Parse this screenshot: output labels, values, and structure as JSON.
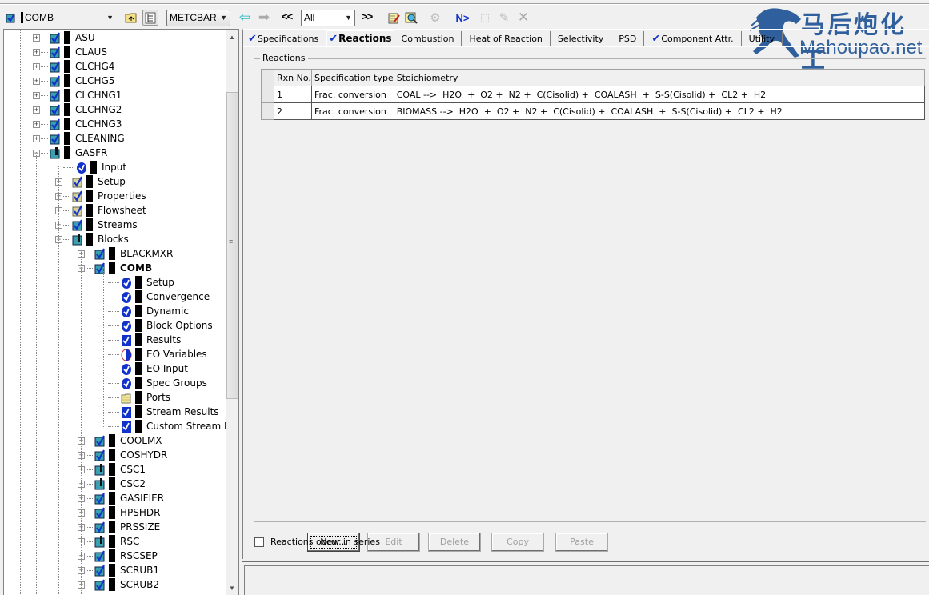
{
  "toolbar": {
    "block_selector": "COMB",
    "units_selector": "METCBAR",
    "filter_selector": "All",
    "prev_label": "<<",
    "next_label": ">>",
    "next_input_label": "N>"
  },
  "logo": {
    "chinese": "马后炮化工",
    "english": "Mahoupao.net"
  },
  "tree": {
    "items": [
      {
        "label": "ASU",
        "level": 1,
        "expander": "+",
        "icon": "block-ok"
      },
      {
        "label": "CLAUS",
        "level": 1,
        "expander": "+",
        "icon": "block-ok"
      },
      {
        "label": "CLCHG4",
        "level": 1,
        "expander": "+",
        "icon": "block-ok"
      },
      {
        "label": "CLCHG5",
        "level": 1,
        "expander": "+",
        "icon": "block-ok"
      },
      {
        "label": "CLCHNG1",
        "level": 1,
        "expander": "+",
        "icon": "block-ok"
      },
      {
        "label": "CLCHNG2",
        "level": 1,
        "expander": "+",
        "icon": "block-ok"
      },
      {
        "label": "CLCHNG3",
        "level": 1,
        "expander": "+",
        "icon": "block-ok"
      },
      {
        "label": "CLEANING",
        "level": 1,
        "expander": "+",
        "icon": "block-ok"
      },
      {
        "label": "GASFR",
        "level": 1,
        "expander": "-",
        "icon": "block-incomplete"
      },
      {
        "label": "Input",
        "level": 2,
        "expander": "",
        "icon": "form-ok"
      },
      {
        "label": "Setup",
        "level": 2,
        "expander": "+",
        "icon": "folder-ok"
      },
      {
        "label": "Properties",
        "level": 2,
        "expander": "+",
        "icon": "folder-ok"
      },
      {
        "label": "Flowsheet",
        "level": 2,
        "expander": "+",
        "icon": "folder-ok"
      },
      {
        "label": "Streams",
        "level": 2,
        "expander": "+",
        "icon": "block-ok"
      },
      {
        "label": "Blocks",
        "level": 2,
        "expander": "-",
        "icon": "block-incomplete"
      },
      {
        "label": "BLACKMXR",
        "level": 3,
        "expander": "+",
        "icon": "block-ok"
      },
      {
        "label": "COMB",
        "level": 3,
        "expander": "-",
        "icon": "block-ok-selected",
        "bold": true
      },
      {
        "label": "Setup",
        "level": 4,
        "expander": "",
        "icon": "form-ok"
      },
      {
        "label": "Convergence",
        "level": 4,
        "expander": "",
        "icon": "form-ok"
      },
      {
        "label": "Dynamic",
        "level": 4,
        "expander": "",
        "icon": "form-ok"
      },
      {
        "label": "Block Options",
        "level": 4,
        "expander": "",
        "icon": "form-ok"
      },
      {
        "label": "Results",
        "level": 4,
        "expander": "",
        "icon": "results-ok"
      },
      {
        "label": "EO Variables",
        "level": 4,
        "expander": "",
        "icon": "form-partial"
      },
      {
        "label": "EO Input",
        "level": 4,
        "expander": "",
        "icon": "form-ok"
      },
      {
        "label": "Spec Groups",
        "level": 4,
        "expander": "",
        "icon": "form-ok"
      },
      {
        "label": "Ports",
        "level": 4,
        "expander": "",
        "icon": "folder"
      },
      {
        "label": "Stream Results",
        "level": 4,
        "expander": "",
        "icon": "results-ok"
      },
      {
        "label": "Custom Stream Resu",
        "level": 4,
        "expander": "",
        "icon": "results-ok"
      },
      {
        "label": "COOLMX",
        "level": 3,
        "expander": "+",
        "icon": "block-ok"
      },
      {
        "label": "COSHYDR",
        "level": 3,
        "expander": "+",
        "icon": "block-ok"
      },
      {
        "label": "CSC1",
        "level": 3,
        "expander": "+",
        "icon": "block-incomplete"
      },
      {
        "label": "CSC2",
        "level": 3,
        "expander": "+",
        "icon": "block-incomplete"
      },
      {
        "label": "GASIFIER",
        "level": 3,
        "expander": "+",
        "icon": "block-ok"
      },
      {
        "label": "HPSHDR",
        "level": 3,
        "expander": "+",
        "icon": "block-ok"
      },
      {
        "label": "PRSSIZE",
        "level": 3,
        "expander": "+",
        "icon": "block-ok"
      },
      {
        "label": "RSC",
        "level": 3,
        "expander": "+",
        "icon": "block-incomplete"
      },
      {
        "label": "RSCSEP",
        "level": 3,
        "expander": "+",
        "icon": "block-ok"
      },
      {
        "label": "SCRUB1",
        "level": 3,
        "expander": "+",
        "icon": "block-ok"
      },
      {
        "label": "SCRUB2",
        "level": 3,
        "expander": "+",
        "icon": "block-ok"
      }
    ]
  },
  "tabs": [
    {
      "label": "Specifications",
      "checked": true,
      "active": false
    },
    {
      "label": "Reactions",
      "checked": true,
      "active": true
    },
    {
      "label": "Combustion",
      "checked": false,
      "active": false
    },
    {
      "label": "Heat of Reaction",
      "checked": false,
      "active": false
    },
    {
      "label": "Selectivity",
      "checked": false,
      "active": false
    },
    {
      "label": "PSD",
      "checked": false,
      "active": false
    },
    {
      "label": "Component Attr.",
      "checked": true,
      "active": false
    },
    {
      "label": "Utility",
      "checked": false,
      "active": false
    }
  ],
  "reactions": {
    "group_label": "Reactions",
    "columns": [
      "Rxn No.",
      "Specification type",
      "Stoichiometry"
    ],
    "rows": [
      {
        "rxn_no": "1",
        "spec_type": "Frac. conversion",
        "stoich": "COAL -->  H2O  +  O2 +  N2 +  C(Cisolid) +  COALASH  +  S-S(Cisolid) +  CL2 +  H2"
      },
      {
        "rxn_no": "2",
        "spec_type": "Frac. conversion",
        "stoich": "BIOMASS -->  H2O  +  O2 +  N2 +  C(Cisolid) +  COALASH  +  S-S(Cisolid) +  CL2 +  H2"
      }
    ],
    "buttons": [
      {
        "label": "New...",
        "enabled": true
      },
      {
        "label": "Edit",
        "enabled": false
      },
      {
        "label": "Delete",
        "enabled": false
      },
      {
        "label": "Copy",
        "enabled": false
      },
      {
        "label": "Paste",
        "enabled": false
      }
    ],
    "series_checkbox": {
      "label": "Reactions occur in series",
      "checked": false
    }
  },
  "colors": {
    "check_blue": "#1133cc",
    "logo_blue": "#2f5f9c"
  }
}
